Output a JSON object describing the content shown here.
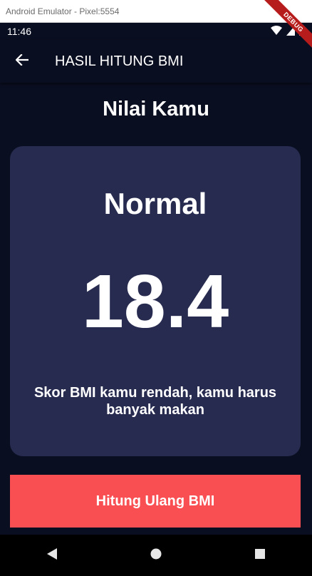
{
  "window": {
    "title": "Android Emulator - Pixel:5554"
  },
  "status_bar": {
    "time": "11:46",
    "debug_label": "DEBUG"
  },
  "app_bar": {
    "title": "HASIL HITUNG BMI"
  },
  "page": {
    "heading": "Nilai Kamu"
  },
  "result": {
    "category": "Normal",
    "bmi": "18.4",
    "advice": "Skor BMI kamu rendah, kamu harus banyak makan"
  },
  "actions": {
    "recalculate_label": "Hitung Ulang BMI"
  },
  "colors": {
    "background": "#0a0e21",
    "card": "#272b50",
    "accent_button": "#f94f52",
    "text": "#ffffff"
  },
  "icons": {
    "back": "arrow-left-icon",
    "wifi": "wifi-icon",
    "signal": "signal-icon",
    "battery": "battery-icon",
    "nav_back": "triangle-back-icon",
    "nav_home": "circle-home-icon",
    "nav_recents": "square-recents-icon"
  }
}
